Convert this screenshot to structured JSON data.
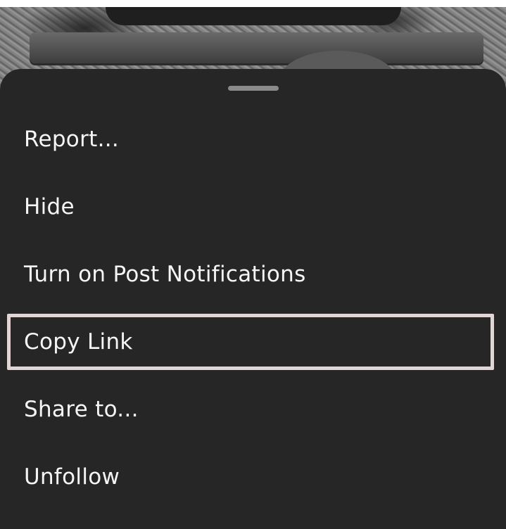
{
  "menu": {
    "items": [
      {
        "label": "Report..."
      },
      {
        "label": "Hide"
      },
      {
        "label": "Turn on Post Notifications"
      },
      {
        "label": "Copy Link",
        "selected": true
      },
      {
        "label": "Share to..."
      },
      {
        "label": "Unfollow"
      }
    ]
  },
  "colors": {
    "sheet_background": "#262626",
    "text": "#f5f5f5",
    "selection_border": "#e2d5d5",
    "handle": "#8a8a8a"
  }
}
